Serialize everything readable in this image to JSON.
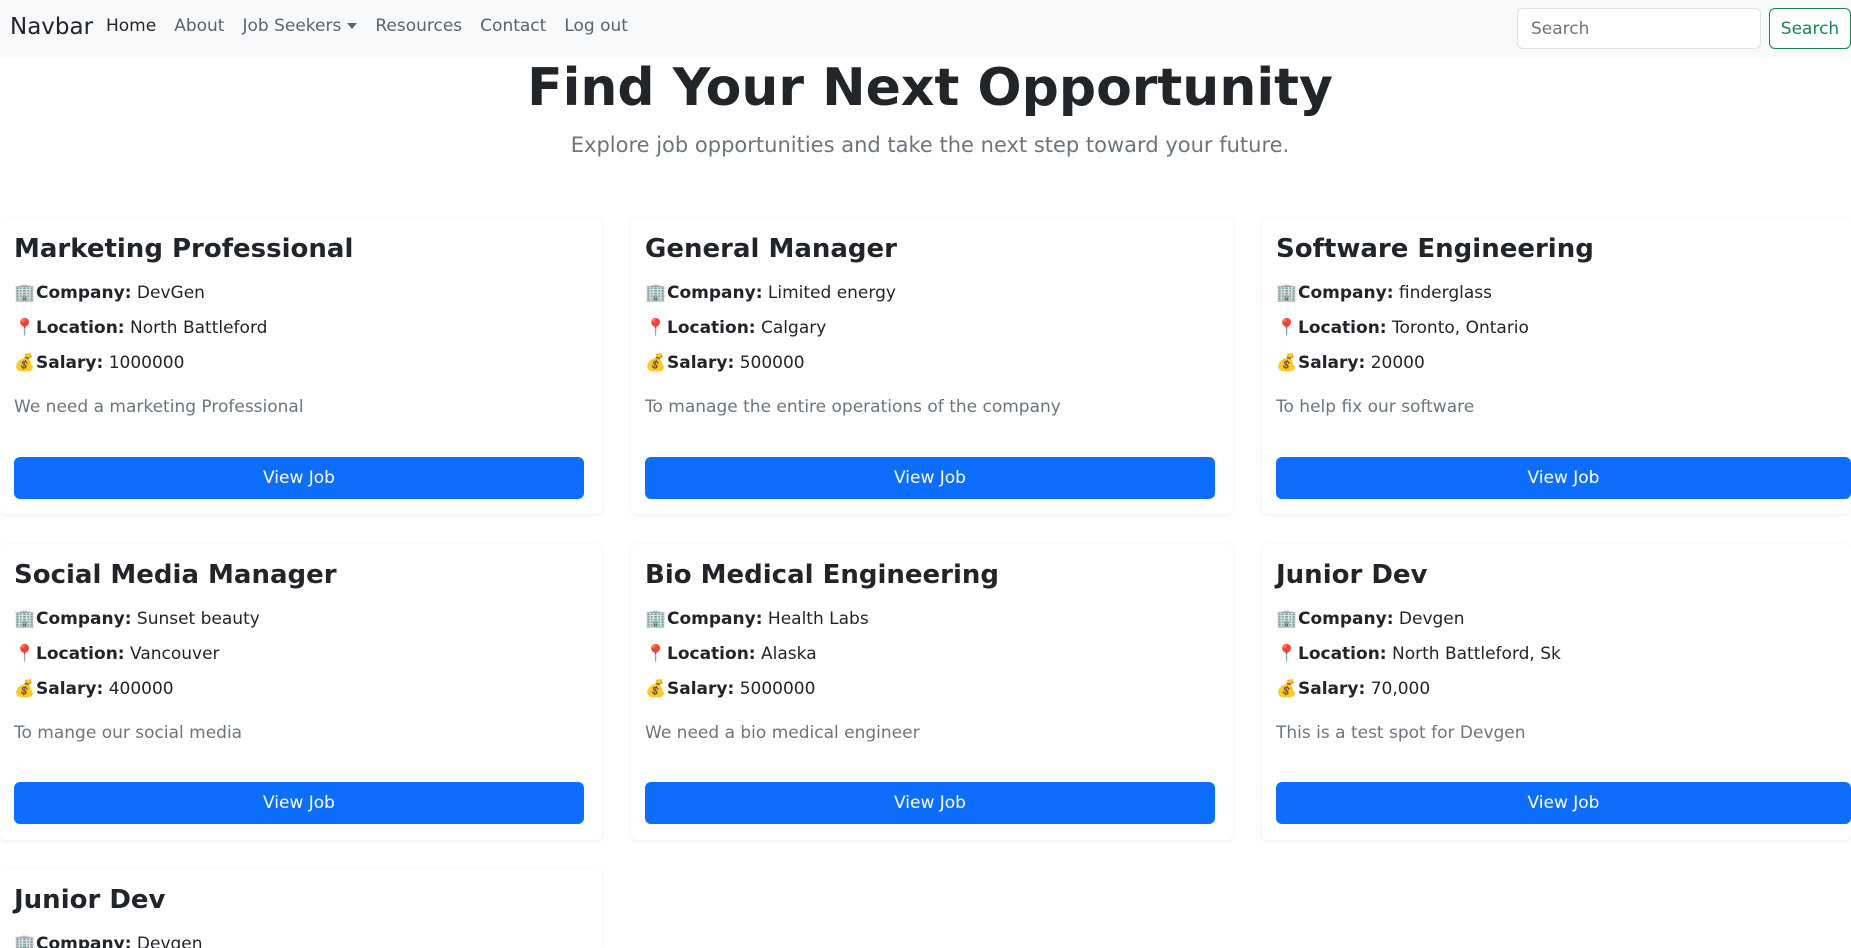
{
  "navbar": {
    "brand": "Navbar",
    "links": [
      {
        "label": "Home"
      },
      {
        "label": "About"
      },
      {
        "label": "Job Seekers"
      },
      {
        "label": "Resources"
      },
      {
        "label": "Contact"
      },
      {
        "label": "Log out"
      }
    ],
    "search_placeholder": "Search",
    "search_button": "Search"
  },
  "hero": {
    "title": "Find Your Next Opportunity",
    "subtitle": "Explore job opportunities and take the next step toward your future."
  },
  "labels": {
    "company": "Company:",
    "location": "Location:",
    "salary": "Salary:",
    "view_job": "View Job"
  },
  "icons": {
    "company": "🏢",
    "location": "📍",
    "salary": "💰"
  },
  "jobs": [
    {
      "title": "Marketing Professional",
      "company": "DevGen",
      "location": "North Battleford",
      "salary": "1000000",
      "description": "We need a marketing Professional"
    },
    {
      "title": "General Manager",
      "company": "Limited energy",
      "location": "Calgary",
      "salary": "500000",
      "description": "To manage the entire operations of the company"
    },
    {
      "title": "Software Engineering",
      "company": "finderglass",
      "location": "Toronto, Ontario",
      "salary": "20000",
      "description": "To help fix our software"
    },
    {
      "title": "Social Media Manager",
      "company": "Sunset beauty",
      "location": "Vancouver",
      "salary": "400000",
      "description": "To mange our social media"
    },
    {
      "title": "Bio Medical Engineering",
      "company": "Health Labs",
      "location": "Alaska",
      "salary": "5000000",
      "description": "We need a bio medical engineer"
    },
    {
      "title": "Junior Dev",
      "company": "Devgen",
      "location": "North Battleford, Sk",
      "salary": "70,000",
      "description": "This is a test spot for Devgen"
    },
    {
      "title": "Junior Dev",
      "company": "Devgen"
    }
  ]
}
